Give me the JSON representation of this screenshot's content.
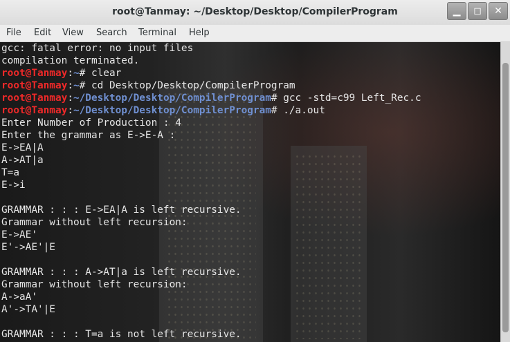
{
  "window": {
    "title": "root@Tanmay: ~/Desktop/Desktop/CompilerProgram",
    "minimize": "▁",
    "maximize": "◻",
    "close": "✕"
  },
  "menu": [
    "File",
    "Edit",
    "View",
    "Search",
    "Terminal",
    "Help"
  ],
  "terminal": {
    "lines": [
      {
        "type": "out",
        "text": "gcc: fatal error: no input files"
      },
      {
        "type": "out",
        "text": "compilation terminated."
      },
      {
        "type": "prompt",
        "user": "root@Tanmay",
        "sep": ":",
        "path": "~",
        "cmd": "# clear"
      },
      {
        "type": "prompt",
        "user": "root@Tanmay",
        "sep": ":",
        "path": "~",
        "cmd": "# cd Desktop/Desktop/CompilerProgram"
      },
      {
        "type": "prompt",
        "user": "root@Tanmay",
        "sep": ":",
        "path": "~/Desktop/Desktop/CompilerProgram",
        "cmd": "# gcc -std=c99 Left_Rec.c"
      },
      {
        "type": "prompt",
        "user": "root@Tanmay",
        "sep": ":",
        "path": "~/Desktop/Desktop/CompilerProgram",
        "cmd": "# ./a.out"
      },
      {
        "type": "out",
        "text": "Enter Number of Production : 4"
      },
      {
        "type": "out",
        "text": "Enter the grammar as E->E-A :"
      },
      {
        "type": "out",
        "text": "E->EA|A"
      },
      {
        "type": "out",
        "text": "A->AT|a"
      },
      {
        "type": "out",
        "text": "T=a"
      },
      {
        "type": "out",
        "text": "E->i"
      },
      {
        "type": "out",
        "text": ""
      },
      {
        "type": "out",
        "text": "GRAMMAR : : : E->EA|A is left recursive."
      },
      {
        "type": "out",
        "text": "Grammar without left recursion:"
      },
      {
        "type": "out",
        "text": "E->AE'"
      },
      {
        "type": "out",
        "text": "E'->AE'|E"
      },
      {
        "type": "out",
        "text": ""
      },
      {
        "type": "out",
        "text": "GRAMMAR : : : A->AT|a is left recursive."
      },
      {
        "type": "out",
        "text": "Grammar without left recursion:"
      },
      {
        "type": "out",
        "text": "A->aA'"
      },
      {
        "type": "out",
        "text": "A'->TA'|E"
      },
      {
        "type": "out",
        "text": ""
      },
      {
        "type": "out",
        "text": "GRAMMAR : : : T=a is not left recursive."
      }
    ]
  },
  "colors": {
    "prompt_user": "#ef2929",
    "prompt_path": "#6f8fd0",
    "text": "#e6e6e6"
  }
}
